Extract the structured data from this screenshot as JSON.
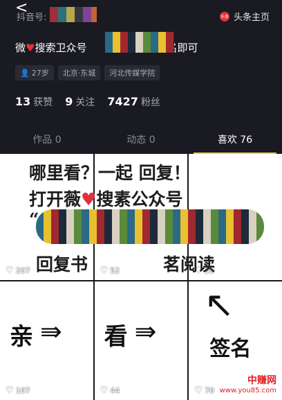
{
  "profile": {
    "back_glyph": "<",
    "douyin_id_label": "抖音号:",
    "toutiao_label": "头条主页",
    "toutiao_badge": "头条",
    "bio_prefix": "微",
    "bio_mid": "搜索卫众号",
    "bio_suffix": "复书名即可",
    "tags": [
      "27岁",
      "北京·东城",
      "河北传媒学院"
    ],
    "stats": [
      {
        "value": "13",
        "label": "获赞"
      },
      {
        "value": "9",
        "label": "关注"
      },
      {
        "value": "7427",
        "label": "粉丝"
      }
    ]
  },
  "tabs": [
    {
      "label": "作品 0"
    },
    {
      "label": "动态 0"
    },
    {
      "label": "喜欢 76"
    }
  ],
  "overlay_text": {
    "line1": "哪里看？一起 回复！",
    "line2": "打开薇",
    "line2b": "搜素公众号",
    "line3": "回复书",
    "line3b": "茗阅读",
    "quote_mark": "“"
  },
  "grid": [
    {
      "likes": "207"
    },
    {
      "likes": "52"
    },
    {
      "likes": "39"
    },
    {
      "likes": "107",
      "char": "亲"
    },
    {
      "likes": "44",
      "char": "看"
    },
    {
      "likes": "70",
      "char": "签名"
    }
  ],
  "watermark": {
    "brand": "中赚网",
    "url": "www.you85.com"
  },
  "colors": {
    "accent": "#f5c842",
    "heart": "#e0313a",
    "person": "#3ec8d8"
  }
}
